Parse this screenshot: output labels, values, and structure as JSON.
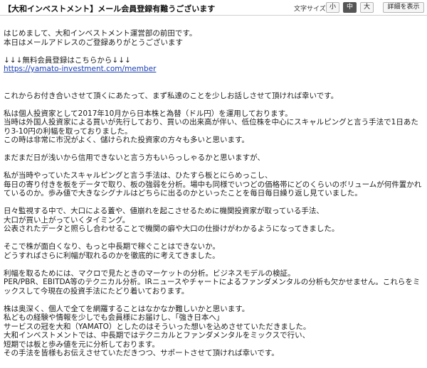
{
  "header": {
    "subject": "【大和インベストメント】メール会員登録有難うございます",
    "font_size_label": "文字サイズ:",
    "size_small": "小",
    "size_medium": "中",
    "size_large": "大",
    "details_button": "詳細を表示"
  },
  "body": {
    "greeting_1": "はじめまして、大和インベストメント運営部の前田です。",
    "greeting_2": "本日はメールアドレスのご登録ありがとうございます",
    "signup_lead": "↓↓↓無料会員登録はこちらから↓↓↓",
    "signup_url": "https://yamato-investment.com/member",
    "intro": "これからお付き合いさせて頂くにあたって、まず私達のことを少しお話しさせて頂ければ幸いです。",
    "p1_1": "私は個人投資家として2017年10月から日本株と為替（ドル円）を運用しております。",
    "p1_2": "当時は外国人投資家による買いが先行しており、買いの出来高が伴い、低位株を中心にスキャルピングと言う手法で1日あたり3-10円の利幅を取っておりました。",
    "p1_3": "この時は非常に市況がよく、儲けられた投資家の方々も多いと思います。",
    "p2": "まだまだ日が浅いから信用できないと言う方もいらっしゃるかと思いますが、",
    "p3_1": "私が当時やっていたスキャルピングと言う手法は、ひたすら板とにらめっこし、",
    "p3_2": "毎日の寄り付きを板をデータで取り、板の強弱を分析。場中も同様でいつどの価格帯にどのくらいのボリュームが何件置かれているのか。歩み値で大きなシグナルはどちらに出るのかといったことを毎日毎日繰り返し見ていました。",
    "p4_1": "日々監視する中で、大口による蓋や、値崩れを起こさせるために機関投資家が取っている手法、",
    "p4_2": "大口が買い上がっていくタイミング。",
    "p4_3": "公表されたデータと照らし合わせることで機関の癖や大口の仕掛けがわかるようになってきました。",
    "p5_1": "そこで株が面白くなり、もっと中長期で稼ぐことはできないか。",
    "p5_2": "どうすればさらに利幅が取れるのかを徹底的に考えてきました。",
    "p6_1": "利幅を取るためには、マクロで見たときのマーケットの分析。ビジネスモデルの検証。",
    "p6_2": "PER/PBR、EBITDA等のテクニカル分析。IRニュースやチャートによるファンダメンタルの分析も欠かせません。これらをミックスして今現在の投資手法にたどり着いております。",
    "p7_1": "株は奥深く、個人で全てを網羅することはなかなか難しいかと思います。",
    "p7_2": "私どもの経験や情報を少しでも会員様にお届けし、「強き日本へ」",
    "p7_3": "サービスの冠を大和（YAMATO）としたのはそういった想いを込めさせていただきました。",
    "p7_4": "大和インベストメントでは、中長期ではテクニカルとファンダメンタルをミックスで行い、",
    "p7_5": "短期では板と歩み値を元に分析しております。",
    "p7_6": "その手法を皆様もお伝えさせていただきつつ、サポートさせて頂ければ幸いです。"
  }
}
